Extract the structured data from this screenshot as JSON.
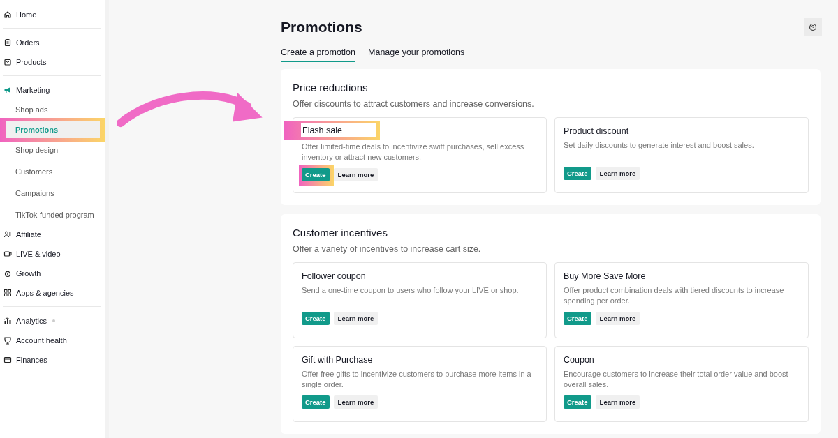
{
  "sidebar": {
    "groups": [
      {
        "items": [
          {
            "label": "Home",
            "selected": false
          }
        ]
      },
      {
        "items": [
          {
            "label": "Orders",
            "selected": false
          },
          {
            "label": "Products",
            "selected": false
          }
        ]
      },
      {
        "items": [
          {
            "label": "Marketing",
            "selected": false,
            "children": [
              {
                "label": "Shop ads",
                "selected": false,
                "highlighted": false
              },
              {
                "label": "Promotions",
                "selected": true,
                "highlighted": true
              },
              {
                "label": "Shop design",
                "selected": false,
                "highlighted": false
              },
              {
                "label": "Customers",
                "selected": false,
                "highlighted": false
              },
              {
                "label": "Campaigns",
                "selected": false,
                "highlighted": false
              },
              {
                "label": "TikTok-funded program",
                "selected": false,
                "highlighted": false
              }
            ]
          },
          {
            "label": "Affiliate",
            "selected": false
          },
          {
            "label": "LIVE & video",
            "selected": false
          },
          {
            "label": "Growth",
            "selected": false
          },
          {
            "label": "Apps & agencies",
            "selected": false
          }
        ]
      },
      {
        "items": [
          {
            "label": "Analytics",
            "selected": false,
            "dot": true
          },
          {
            "label": "Account health",
            "selected": false
          },
          {
            "label": "Finances",
            "selected": false
          }
        ]
      }
    ]
  },
  "page": {
    "title": "Promotions"
  },
  "tabs": [
    {
      "label": "Create a promotion",
      "selected": true
    },
    {
      "label": "Manage your promotions",
      "selected": false
    }
  ],
  "sections": [
    {
      "title": "Price reductions",
      "subtitle": "Offer discounts to attract customers and increase conversions.",
      "cards": [
        {
          "title": "Flash sale",
          "description": "Offer limited-time deals to incentivize swift purchases, sell excess inventory or attract new customers.",
          "highlighted": true,
          "primary": "Create",
          "secondary": "Learn more"
        },
        {
          "title": "Product discount",
          "description": "Set daily discounts to generate interest and boost sales.",
          "highlighted": false,
          "primary": "Create",
          "secondary": "Learn more"
        }
      ]
    },
    {
      "title": "Customer incentives",
      "subtitle": "Offer a variety of incentives to increase cart size.",
      "cards": [
        {
          "title": "Follower coupon",
          "description": "Send a one-time coupon to users who follow your LIVE or shop.",
          "highlighted": false,
          "primary": "Create",
          "secondary": "Learn more"
        },
        {
          "title": "Buy More Save More",
          "description": "Offer product combination deals with tiered discounts to increase spending per order.",
          "highlighted": false,
          "primary": "Create",
          "secondary": "Learn more"
        },
        {
          "title": "Gift with Purchase",
          "description": "Offer free gifts to incentivize customers to purchase more items in a single order.",
          "highlighted": false,
          "primary": "Create",
          "secondary": "Learn more"
        },
        {
          "title": "Coupon",
          "description": "Encourage customers to increase their total order value and boost overall sales.",
          "highlighted": false,
          "primary": "Create",
          "secondary": "Learn more"
        }
      ]
    }
  ]
}
